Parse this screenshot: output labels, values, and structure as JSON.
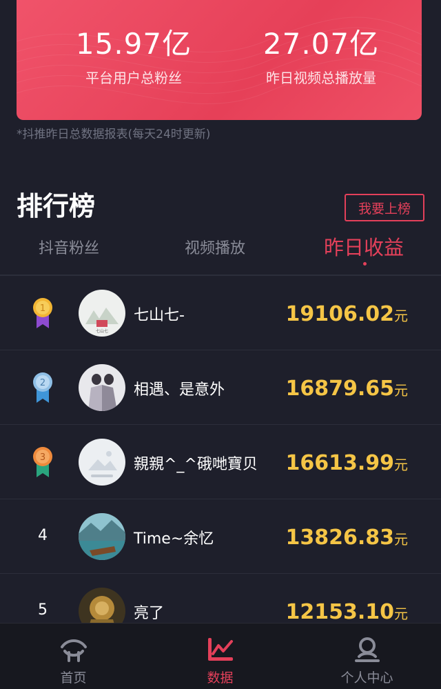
{
  "stats": {
    "fans_value": "15.97亿",
    "fans_label": "平台用户总粉丝",
    "plays_value": "27.07亿",
    "plays_label": "昨日视频总播放量"
  },
  "note": "*抖推昨日总数据报表(每天24时更新)",
  "ranking": {
    "title": "排行榜",
    "join_button": "我要上榜",
    "tabs": [
      "抖音粉丝",
      "视频播放",
      "昨日收益"
    ],
    "active_tab": 2,
    "rows": [
      {
        "rank": "1",
        "name": "七山七-",
        "amount": "19106.02",
        "unit": "元"
      },
      {
        "rank": "2",
        "name": "相遇、是意外",
        "amount": "16879.65",
        "unit": "元"
      },
      {
        "rank": "3",
        "name": "親親^_^硪哋寶贝",
        "amount": "16613.99",
        "unit": "元"
      },
      {
        "rank": "4",
        "name": "Time~余忆",
        "amount": "13826.83",
        "unit": "元"
      },
      {
        "rank": "5",
        "name": "亮了",
        "amount": "12153.10",
        "unit": "元"
      }
    ]
  },
  "nav": {
    "items": [
      {
        "label": "首页",
        "icon": "home-icon"
      },
      {
        "label": "数据",
        "icon": "chart-icon"
      },
      {
        "label": "个人中心",
        "icon": "user-icon"
      }
    ],
    "active": 1
  },
  "colors": {
    "accent": "#e4405a",
    "gold": "#f5c546",
    "background": "#1e1f2b"
  }
}
